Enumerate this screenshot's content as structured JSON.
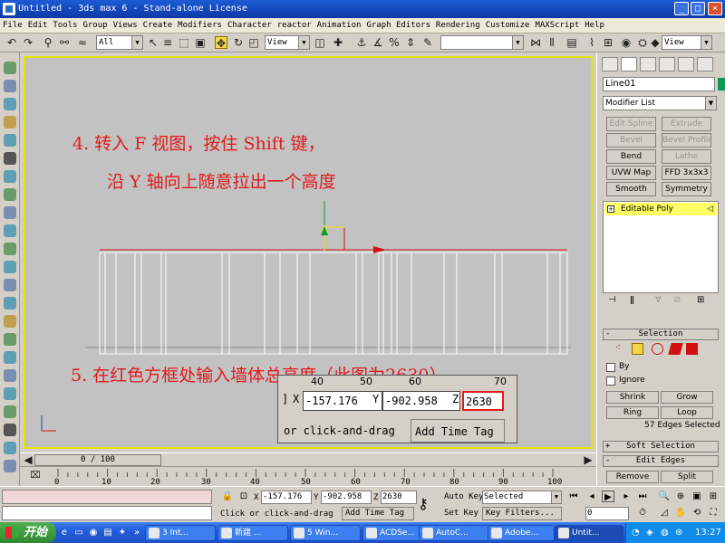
{
  "title_bar": {
    "title": "Untitled - 3ds max 6 - Stand-alone License",
    "min": "_",
    "max": "□",
    "close": "×"
  },
  "menu": [
    "File",
    "Edit",
    "Tools",
    "Group",
    "Views",
    "Create",
    "Modifiers",
    "Character",
    "reactor",
    "Animation",
    "Graph Editors",
    "Rendering",
    "Customize",
    "MAXScript",
    "Help"
  ],
  "toolbar": {
    "selection_filter": "All",
    "reference_coord": "View",
    "named_selection": "",
    "render_type": "View"
  },
  "annotations": {
    "step4_line1": "4. 转入 F 视图，按住 Shift 键，",
    "step4_line2": "沿 Y 轴向上随意拉出一个高度",
    "step5": "5. 在红色方框处输入墙体总高度（此图为2630）"
  },
  "inset": {
    "ruler": [
      "40",
      "50",
      "60",
      "70"
    ],
    "x_label": "X",
    "x_value": "-157.176",
    "y_label": "Y",
    "y_value": "-902.958",
    "z_label": "Z",
    "z_value": "2630",
    "prompt": "or click-and-drag",
    "add_time_tag": "Add Time Tag"
  },
  "timeslider": {
    "position": "0 / 100"
  },
  "trackbar_ticks": [
    "0",
    "10",
    "20",
    "30",
    "40",
    "50",
    "60",
    "70",
    "80",
    "90",
    "100"
  ],
  "command_panel": {
    "object_name": "Line01",
    "modifier_list": "Modifier List",
    "modifier_buttons": [
      {
        "label": "Edit Spline",
        "dim": true
      },
      {
        "label": "Extrude",
        "dim": true
      },
      {
        "label": "Bevel",
        "dim": true
      },
      {
        "label": "Bevel Profile",
        "dim": true
      },
      {
        "label": "Bend",
        "dim": false
      },
      {
        "label": "Lathe",
        "dim": true
      },
      {
        "label": "UVW Map",
        "dim": false
      },
      {
        "label": "FFD 3x3x3",
        "dim": false
      },
      {
        "label": "Smooth",
        "dim": false
      },
      {
        "label": "Symmetry",
        "dim": false
      }
    ],
    "stack_item": "Editable Poly",
    "selection_title": "Selection",
    "by_label": "By",
    "ignore_label": "Ignore",
    "shrink": "Shrink",
    "grow": "Grow",
    "ring": "Ring",
    "loop": "Loop",
    "selected_info": "57 Edges Selected",
    "soft_selection_title": "Soft Selection",
    "edit_edges_title": "Edit Edges",
    "remove": "Remove",
    "split": "Split"
  },
  "statusbar": {
    "prompt": "Click or click-and-drag",
    "add_time_tag": "Add Time Tag",
    "x_label": "X",
    "x_value": "-157.176",
    "y_label": "Y",
    "y_value": "-902.958",
    "z_label": "Z",
    "z_value": "2630",
    "auto_key": "Auto Key",
    "set_key": "Set Key",
    "selected": "Selected",
    "key_filters": "Key Filters...",
    "frame": "0"
  },
  "taskbar": {
    "start": "开始",
    "items": [
      "3 Int...",
      "新建 ...",
      "5 Win...",
      "ACDSe...",
      "AutoC...",
      "Adobe...",
      "Untit..."
    ],
    "clock": "13:27"
  },
  "colors": {
    "viewport_bg": "#c2c2c2",
    "viewport_border": "#e4e200",
    "annotation": "#e21a1a",
    "wall_line": "#d01010"
  }
}
